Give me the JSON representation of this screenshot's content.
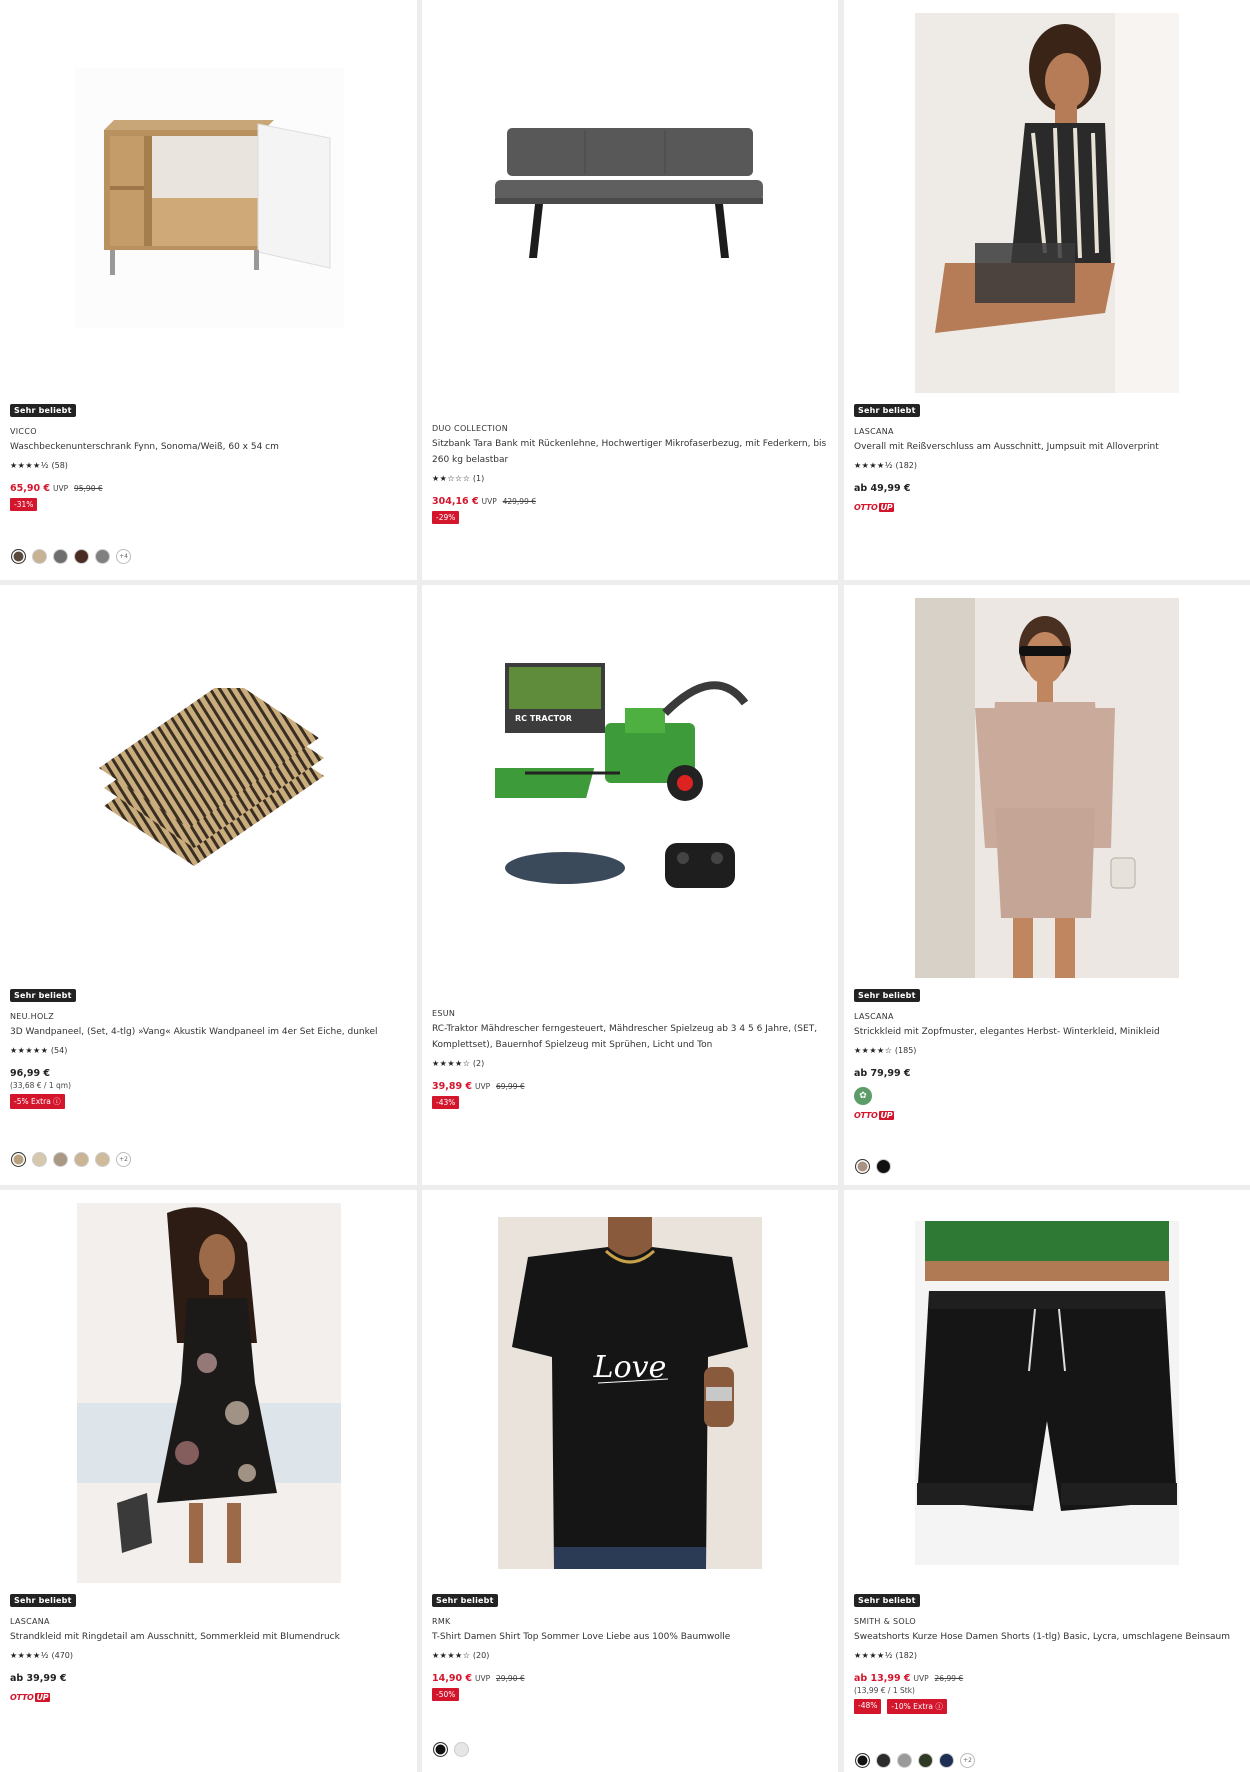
{
  "products": [
    {
      "badge": "Sehr beliebt",
      "brand": "VICCO",
      "title": "Waschbeckenunterschrank Fynn, Sonoma/Weiß, 60 x 54 cm",
      "stars": "★★★★½",
      "reviews": "(58)",
      "price": "65,90 €",
      "uvp_label": "UVP",
      "uvp_price": "95,90 €",
      "discounts": [
        "-31%"
      ],
      "swatches": [
        "#5a4a3e",
        "#c8b294",
        "#6e6e6e",
        "#4a2c22",
        "#808080"
      ],
      "more": "+4",
      "image": "bathroom-cabinet"
    },
    {
      "badge": "",
      "brand": "DUO COLLECTION",
      "title": "Sitzbank Tara Bank mit Rückenlehne, Hochwertiger Mikrofaserbezug, mit Federkern, bis 260 kg belastbar",
      "stars": "★★☆☆☆",
      "reviews": "(1)",
      "price": "304,16 €",
      "uvp_label": "UVP",
      "uvp_price": "429,99 €",
      "discounts": [
        "-29%"
      ],
      "image": "bench"
    },
    {
      "badge": "Sehr beliebt",
      "brand": "LASCANA",
      "title": "Overall mit Reißverschluss am Ausschnitt, Jumpsuit mit Alloverprint",
      "stars": "★★★★½",
      "reviews": "(182)",
      "price": "ab 49,99 €",
      "ottoup": "OTTO",
      "ottoup_up": "UP",
      "image": "jumpsuit"
    },
    {
      "badge": "Sehr beliebt",
      "brand": "NEU.HOLZ",
      "title": "3D Wandpaneel, (Set, 4-tlg) »Vang« Akustik Wandpaneel im 4er Set Eiche, dunkel",
      "stars": "★★★★★",
      "reviews": "(54)",
      "price": "96,99 €",
      "unit": "(33,68 € / 1 qm)",
      "discounts": [
        "-5% Extra ⓘ"
      ],
      "swatches": [
        "#b9a07e",
        "#d6c8ad",
        "#a89884",
        "#c9b493",
        "#cdbb9b"
      ],
      "more": "+2",
      "image": "wall-panels"
    },
    {
      "badge": "",
      "brand": "ESUN",
      "title": "RC-Traktor Mähdrescher ferngesteuert, Mähdrescher Spielzeug ab 3 4 5 6 Jahre, (SET, Komplettset), Bauernhof Spielzeug mit Sprühen, Licht und Ton",
      "stars": "★★★★☆",
      "reviews": "(2)",
      "price": "39,89 €",
      "uvp_label": "UVP",
      "uvp_price": "69,99 €",
      "discounts": [
        "-43%"
      ],
      "image": "rc-harvester",
      "box_label": "RC TRACTOR"
    },
    {
      "badge": "Sehr beliebt",
      "brand": "LASCANA",
      "title": "Strickkleid mit Zopfmuster, elegantes Herbst- Winterkleid, Minikleid",
      "stars": "★★★★☆",
      "reviews": "(185)",
      "price": "ab 79,99 €",
      "sustainable": true,
      "ottoup": "OTTO",
      "ottoup_up": "UP",
      "swatches": [
        "#a89284",
        "#111111"
      ],
      "image": "knit-dress"
    },
    {
      "badge": "Sehr beliebt",
      "brand": "LASCANA",
      "title": "Strandkleid mit Ringdetail am Ausschnitt, Sommerkleid mit Blumendruck",
      "stars": "★★★★½",
      "reviews": "(470)",
      "price": "ab 39,99 €",
      "ottoup": "OTTO",
      "ottoup_up": "UP",
      "image": "beach-dress"
    },
    {
      "badge": "Sehr beliebt",
      "brand": "RMK",
      "title": "T-Shirt Damen Shirt Top Sommer Love Liebe aus 100% Baumwolle",
      "stars": "★★★★☆",
      "reviews": "(20)",
      "price": "14,90 €",
      "uvp_label": "UVP",
      "uvp_price": "29,90 €",
      "discounts": [
        "-50%"
      ],
      "swatches": [
        "#111111",
        "#e6e6e6"
      ],
      "image": "tshirt",
      "shirt_print": "Love"
    },
    {
      "badge": "Sehr beliebt",
      "brand": "SMITH & SOLO",
      "title": "Sweatshorts Kurze Hose Damen Shorts (1-tlg) Basic, Lycra, umschlagene Beinsaum",
      "stars": "★★★★½",
      "reviews": "(182)",
      "price": "ab 13,99 €",
      "uvp_label": "UVP",
      "uvp_price": "26,99 €",
      "unit": "(13,99 € / 1 Stk)",
      "discounts": [
        "-48%",
        "-10% Extra ⓘ"
      ],
      "swatches": [
        "#111111",
        "#2b2b2b",
        "#9a9a9a",
        "#2f3a25",
        "#1d2f52"
      ],
      "more": "+2",
      "image": "sweatshorts"
    }
  ]
}
